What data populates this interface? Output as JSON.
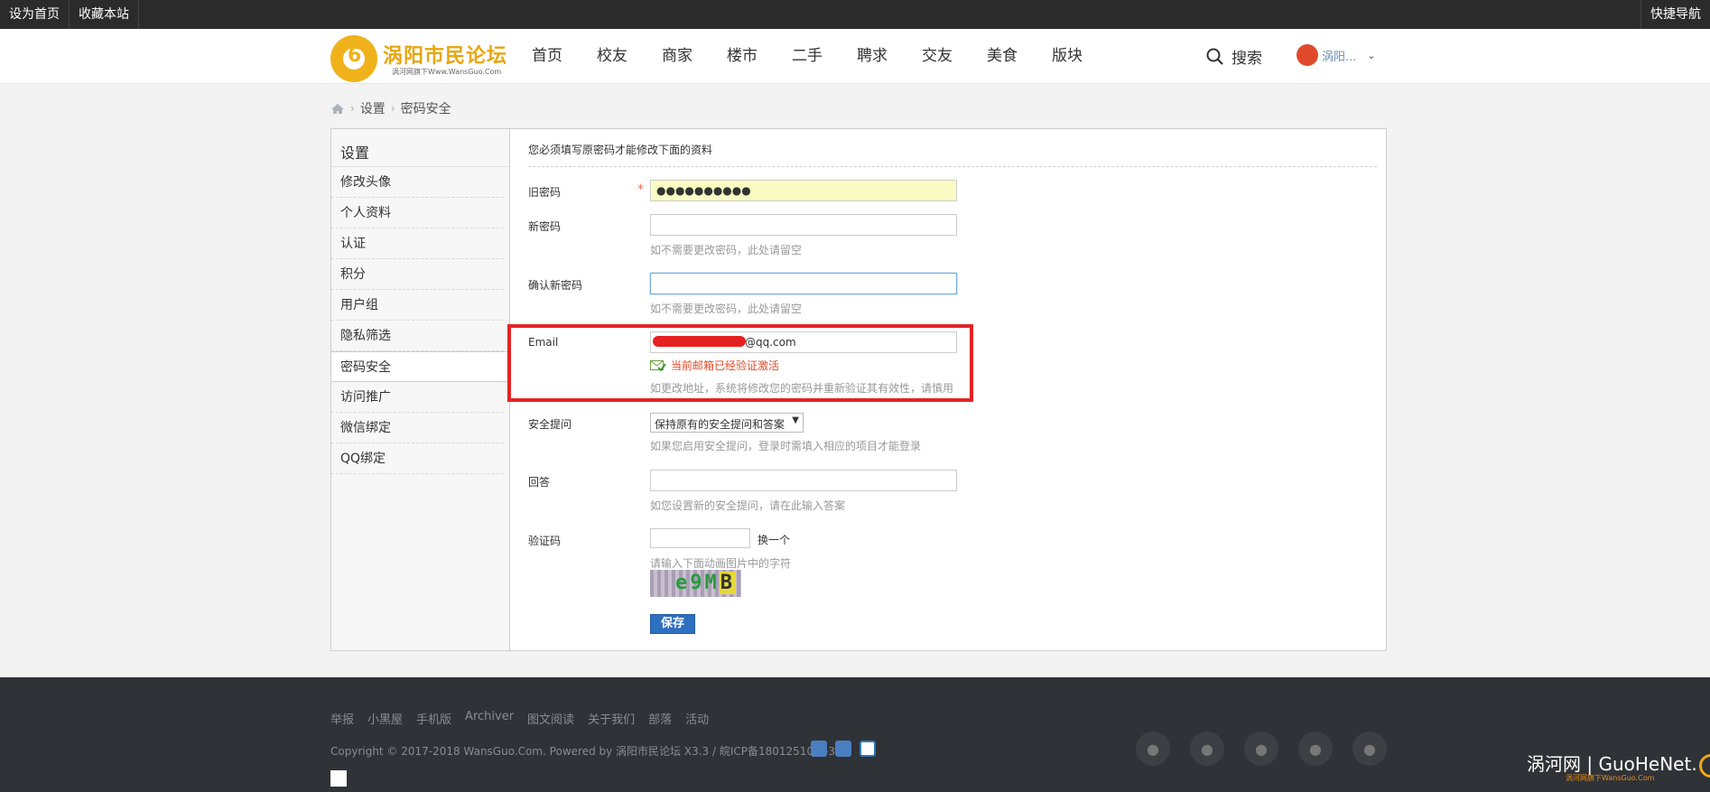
{
  "topbar": {
    "set_home": "设为首页",
    "bookmark": "收藏本站",
    "quick_nav": "快捷导航"
  },
  "logo": {
    "name": "涡阳市民论坛",
    "sub": "涡河网旗下Www.WansGuo.Com",
    "mark": "6"
  },
  "nav": [
    "首页",
    "校友",
    "商家",
    "楼市",
    "二手",
    "聘求",
    "交友",
    "美食",
    "版块"
  ],
  "search_label": "搜索",
  "user": {
    "name": "涡阳...",
    "chevron": "⌄"
  },
  "breadcrumb": {
    "home_icon": "home-icon",
    "sep": "›",
    "level1": "设置",
    "level2": "密码安全"
  },
  "sidebar": {
    "title": "设置",
    "items": [
      "修改头像",
      "个人资料",
      "认证",
      "积分",
      "用户组",
      "隐私筛选",
      "密码安全",
      "访问推广",
      "微信绑定",
      "QQ绑定"
    ],
    "active": "密码安全"
  },
  "form": {
    "notice": "您必须填写原密码才能修改下面的资料",
    "old_password": {
      "label": "旧密码",
      "required": "*",
      "value": "●●●●●●●●●●"
    },
    "new_password": {
      "label": "新密码",
      "hint": "如不需要更改密码，此处请留空"
    },
    "confirm_password": {
      "label": "确认新密码",
      "hint": "如不需要更改密码，此处请留空"
    },
    "email": {
      "label": "Email",
      "value": "@qq.com",
      "verified": "当前邮箱已经验证激活",
      "hint": "如更改地址，系统将修改您的密码并重新验证其有效性，请慎用"
    },
    "security_question": {
      "label": "安全提问",
      "selected": "保持原有的安全提问和答案",
      "hint": "如果您启用安全提问，登录时需填入相应的项目才能登录"
    },
    "answer": {
      "label": "回答",
      "hint": "如您设置新的安全提问，请在此输入答案"
    },
    "captcha": {
      "label": "验证码",
      "change": "换一个",
      "hint": "请输入下面动画图片中的字符",
      "image_text": "e9M",
      "image_last": "B"
    },
    "save": "保存"
  },
  "footer": {
    "links": [
      "举报",
      "小黑屋",
      "手机版",
      "Archiver",
      "图文阅读",
      "关于我们",
      "部落",
      "活动"
    ],
    "copyright": "Copyright © 2017-2018 WansGuo.Com. Powered by 涡阳市民论坛 X3.3 / 皖ICP备18012510号-3",
    "social_icons": [
      "wechat-icon",
      "apple-icon",
      "android-icon",
      "weibo-icon",
      "rss-icon"
    ],
    "watermark": "涡河网 | GuoHeNet.",
    "watermark_sub": "涡河网旗下WansGuo.Com"
  }
}
